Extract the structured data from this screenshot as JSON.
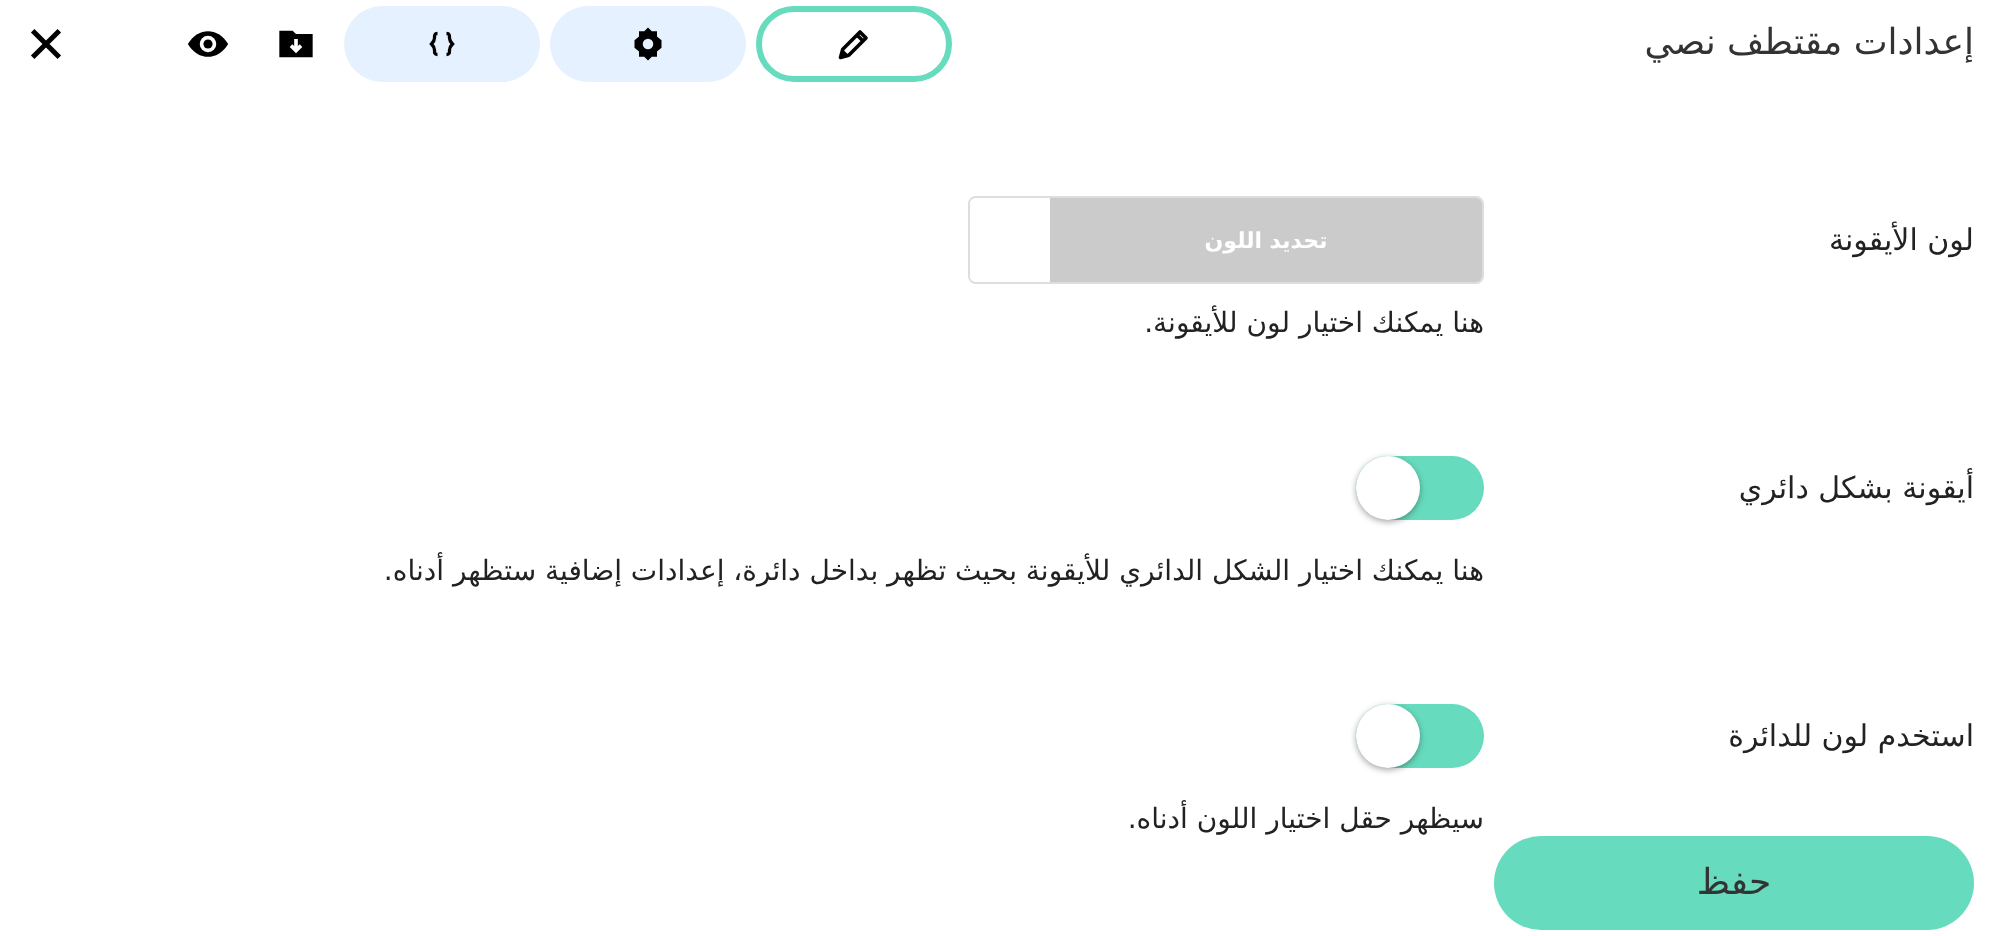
{
  "header": {
    "title": "إعدادات مقتطف نصي",
    "tabs": [
      {
        "kind": "edit",
        "selected": true
      },
      {
        "kind": "settings",
        "selected": false
      },
      {
        "kind": "code",
        "selected": false
      }
    ]
  },
  "settings": [
    {
      "kind": "color",
      "label": "لون الأيقونة",
      "button": "تحديد اللون",
      "description": "هنا يمكنك اختيار لون للأيقونة."
    },
    {
      "kind": "toggle",
      "label": "أيقونة بشكل دائري",
      "on": true,
      "description": "هنا يمكنك اختيار الشكل الدائري للأيقونة بحيث تظهر بداخل دائرة، إعدادات إضافية ستظهر أدناه."
    },
    {
      "kind": "toggle",
      "label": "استخدم لون للدائرة",
      "on": true,
      "description": "سيظهر حقل اختيار اللون أدناه."
    }
  ],
  "save_button": "حفظ"
}
